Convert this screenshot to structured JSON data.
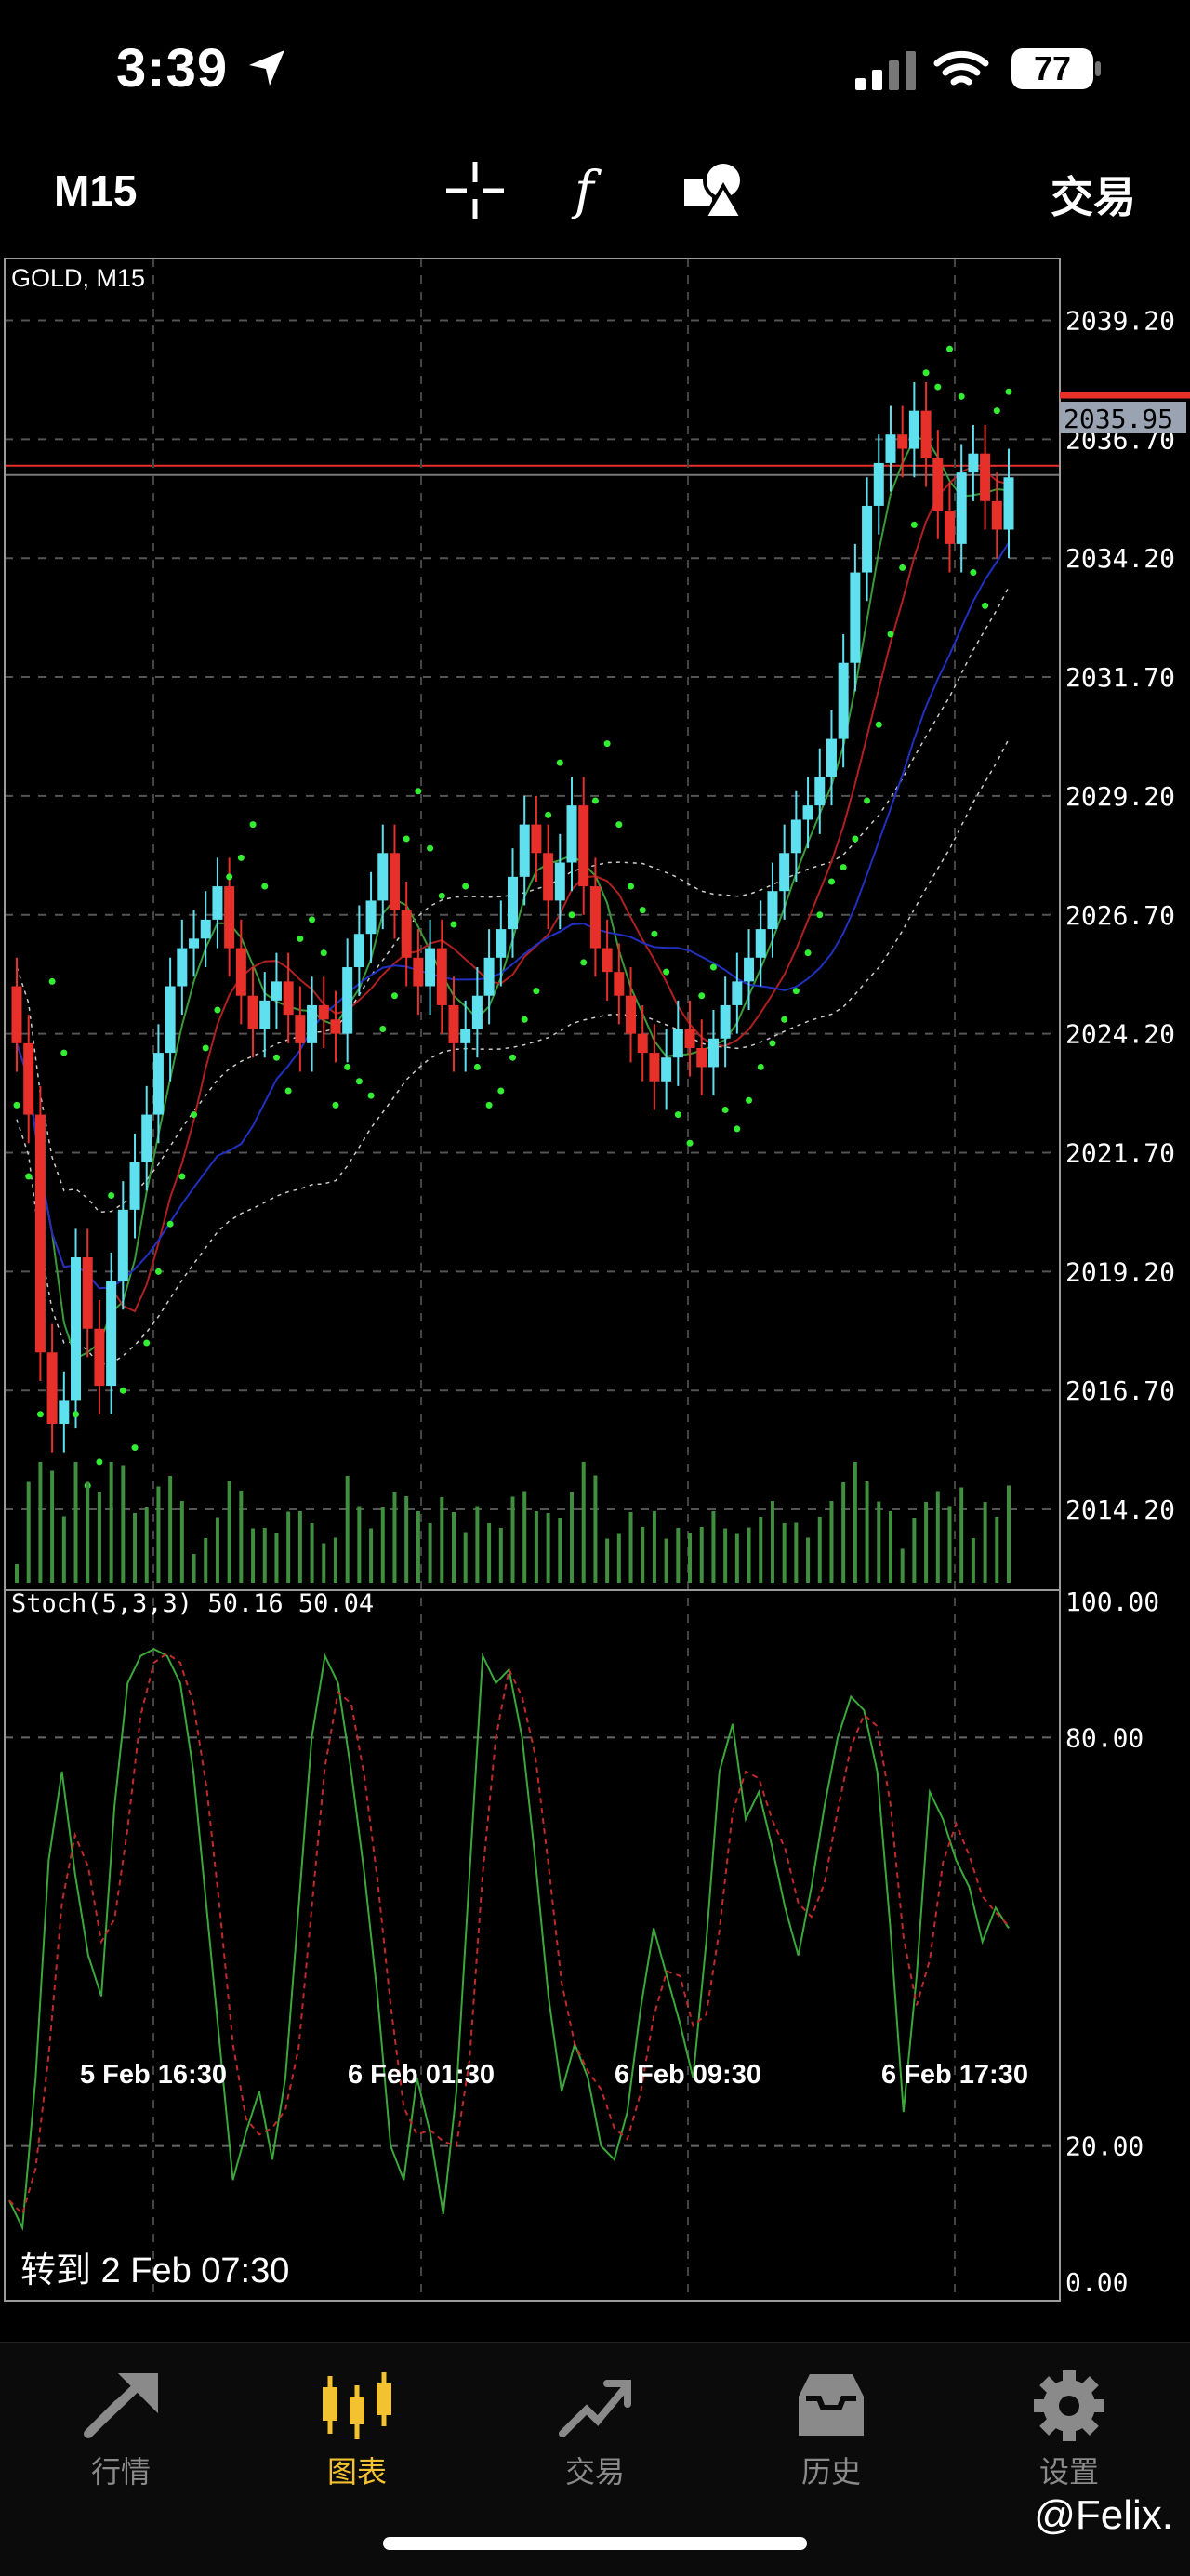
{
  "status_bar": {
    "time": "3:39",
    "battery": "77"
  },
  "toolbar": {
    "timeframe": "M15",
    "trade_label": "交易",
    "icons": [
      "crosshair-icon",
      "function-icon",
      "shapes-icon"
    ]
  },
  "chart": {
    "symbol_label": "GOLD, M15",
    "price_ticks": [
      "2039.20",
      "2036.70",
      "2034.20",
      "2031.70",
      "2029.20",
      "2026.70",
      "2024.20",
      "2021.70",
      "2019.20",
      "2016.70",
      "2014.20"
    ],
    "current_price": "2035.95",
    "oscillator_label": "Stoch(5,3,3) 50.16 50.04",
    "oscillator_ticks": [
      "100.00",
      "80.00",
      "20.00",
      "0.00"
    ],
    "time_ticks": [
      "5 Feb 16:30",
      "6 Feb 01:30",
      "6 Feb 09:30",
      "6 Feb 17:30"
    ],
    "goto_label": "转到 2 Feb 07:30",
    "colors": {
      "up": "#5fe0ee",
      "down": "#e8302a",
      "sar": "#33ee33",
      "volume": "#3f8f3f",
      "current_price": "#e8302a"
    }
  },
  "chart_data": {
    "type": "candlestick",
    "symbol": "GOLD",
    "timeframe": "M15",
    "ylim": [
      2012.5,
      2040.5
    ],
    "close_series": [
      2024.0,
      2022.5,
      2017.5,
      2016.0,
      2016.5,
      2019.5,
      2018.0,
      2016.8,
      2019.0,
      2020.5,
      2021.5,
      2022.5,
      2023.8,
      2025.2,
      2026.0,
      2026.2,
      2026.6,
      2027.3,
      2026.0,
      2025.0,
      2024.3,
      2024.9,
      2025.3,
      2024.6,
      2024.0,
      2024.8,
      2024.5,
      2024.2,
      2025.6,
      2026.3,
      2027.0,
      2028.0,
      2026.8,
      2025.8,
      2025.2,
      2026.0,
      2024.8,
      2024.0,
      2024.3,
      2025.0,
      2025.8,
      2026.4,
      2027.5,
      2028.6,
      2028.0,
      2027.0,
      2027.8,
      2029.0,
      2027.3,
      2026.0,
      2025.5,
      2025.0,
      2024.2,
      2023.8,
      2023.2,
      2023.7,
      2024.3,
      2023.9,
      2023.5,
      2024.1,
      2024.8,
      2025.3,
      2025.8,
      2026.4,
      2027.2,
      2028.0,
      2028.7,
      2029.0,
      2029.6,
      2030.4,
      2032.0,
      2033.9,
      2035.3,
      2036.2,
      2036.8,
      2036.5,
      2037.3,
      2036.3,
      2035.2,
      2034.5,
      2036.0,
      2036.4,
      2035.4,
      2034.8,
      2035.9
    ],
    "stochastic": {
      "params": "5,3,3",
      "main": 50.16,
      "signal": 50.04,
      "levels": [
        20,
        80
      ],
      "main_series": [
        12,
        8,
        30,
        62,
        75,
        60,
        48,
        42,
        70,
        88,
        92,
        93,
        92,
        88,
        75,
        55,
        35,
        15,
        22,
        28,
        18,
        30,
        55,
        80,
        92,
        88,
        75,
        60,
        42,
        20,
        15,
        30,
        22,
        10,
        28,
        60,
        92,
        88,
        90,
        80,
        62,
        42,
        28,
        35,
        30,
        20,
        18,
        25,
        40,
        52,
        45,
        38,
        30,
        50,
        75,
        82,
        68,
        72,
        64,
        55,
        48,
        58,
        70,
        80,
        86,
        84,
        75,
        52,
        25,
        45,
        72,
        68,
        62,
        58,
        50,
        55,
        52
      ]
    },
    "xlabels": [
      "5 Feb 16:30",
      "6 Feb 01:30",
      "6 Feb 09:30",
      "6 Feb 17:30"
    ]
  }
}
